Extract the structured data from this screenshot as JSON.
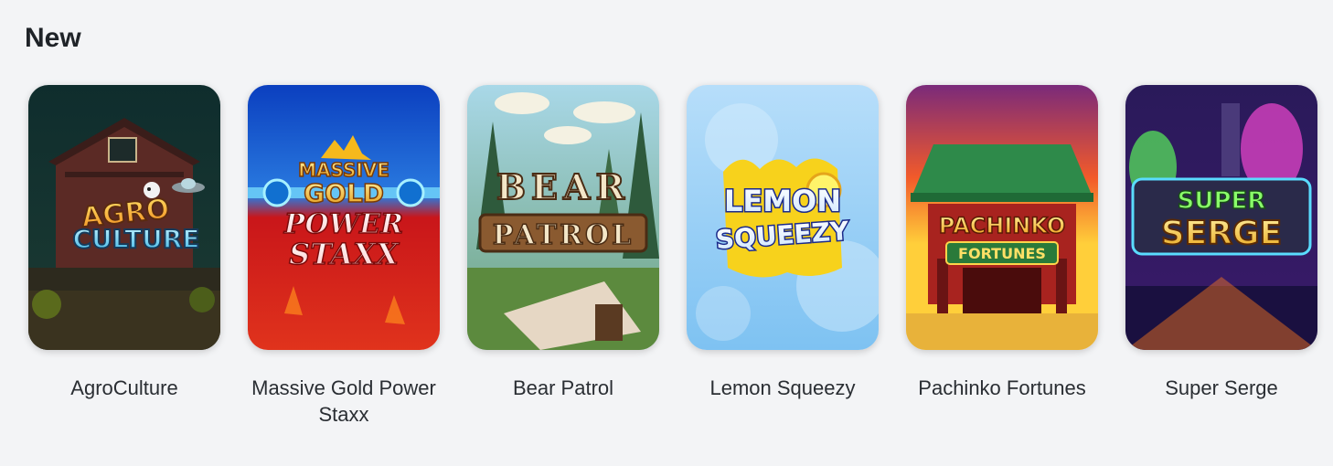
{
  "section": {
    "title": "New"
  },
  "games": [
    {
      "name": "AgroCulture",
      "logo_top": "AGRO",
      "logo_bottom": "CULTURE"
    },
    {
      "name": "Massive Gold Power Staxx",
      "logo_top": "MASSIVE",
      "logo_mid": "GOLD",
      "logo_l1": "POWER",
      "logo_l2": "STAXX"
    },
    {
      "name": "Bear Patrol",
      "logo_top": "BEAR",
      "logo_bottom": "PATROL"
    },
    {
      "name": "Lemon Squeezy",
      "logo_top": "LEMON",
      "logo_bottom": "SQUEEZY"
    },
    {
      "name": "Pachinko Fortunes",
      "logo_top": "PACHINKO",
      "logo_bottom": "FORTUNES"
    },
    {
      "name": "Super Serge",
      "logo_top": "SUPER",
      "logo_bottom": "SERGE"
    }
  ],
  "colors": {
    "background": "#f3f4f6",
    "text": "#2a2e33"
  }
}
